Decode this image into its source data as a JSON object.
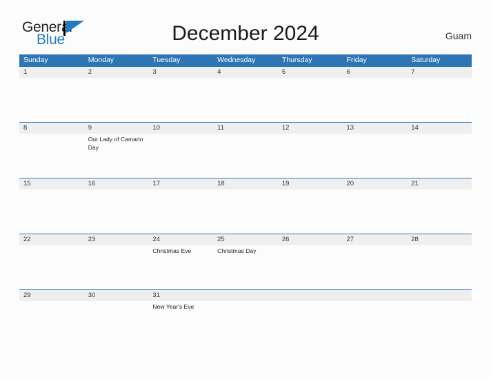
{
  "brand": {
    "name_part1": "General",
    "name_part2": "Blue",
    "flag_icon": "general-blue-flag-icon",
    "colors": {
      "blue": "#1e7bc4",
      "black": "#231f20"
    }
  },
  "header": {
    "title": "December 2024",
    "region": "Guam"
  },
  "theme": {
    "header_blue": "#2e75b6",
    "date_strip_gray": "#efefef",
    "page_background": "#fcfcfc",
    "text_color": "#333333"
  },
  "calendar": {
    "month": "December",
    "year": "2024",
    "weekday_headers": [
      "Sunday",
      "Monday",
      "Tuesday",
      "Wednesday",
      "Thursday",
      "Friday",
      "Saturday"
    ],
    "weeks": [
      {
        "days": [
          {
            "num": "1",
            "events": []
          },
          {
            "num": "2",
            "events": []
          },
          {
            "num": "3",
            "events": []
          },
          {
            "num": "4",
            "events": []
          },
          {
            "num": "5",
            "events": []
          },
          {
            "num": "6",
            "events": []
          },
          {
            "num": "7",
            "events": []
          }
        ]
      },
      {
        "days": [
          {
            "num": "8",
            "events": []
          },
          {
            "num": "9",
            "events": [
              "Our Lady of Camarin Day"
            ]
          },
          {
            "num": "10",
            "events": []
          },
          {
            "num": "11",
            "events": []
          },
          {
            "num": "12",
            "events": []
          },
          {
            "num": "13",
            "events": []
          },
          {
            "num": "14",
            "events": []
          }
        ]
      },
      {
        "days": [
          {
            "num": "15",
            "events": []
          },
          {
            "num": "16",
            "events": []
          },
          {
            "num": "17",
            "events": []
          },
          {
            "num": "18",
            "events": []
          },
          {
            "num": "19",
            "events": []
          },
          {
            "num": "20",
            "events": []
          },
          {
            "num": "21",
            "events": []
          }
        ]
      },
      {
        "days": [
          {
            "num": "22",
            "events": []
          },
          {
            "num": "23",
            "events": []
          },
          {
            "num": "24",
            "events": [
              "Christmas Eve"
            ]
          },
          {
            "num": "25",
            "events": [
              "Christmas Day"
            ]
          },
          {
            "num": "26",
            "events": []
          },
          {
            "num": "27",
            "events": []
          },
          {
            "num": "28",
            "events": []
          }
        ]
      },
      {
        "days": [
          {
            "num": "29",
            "events": []
          },
          {
            "num": "30",
            "events": []
          },
          {
            "num": "31",
            "events": [
              "New Year's Eve"
            ]
          },
          {
            "num": "",
            "events": []
          },
          {
            "num": "",
            "events": []
          },
          {
            "num": "",
            "events": []
          },
          {
            "num": "",
            "events": []
          }
        ]
      }
    ]
  }
}
